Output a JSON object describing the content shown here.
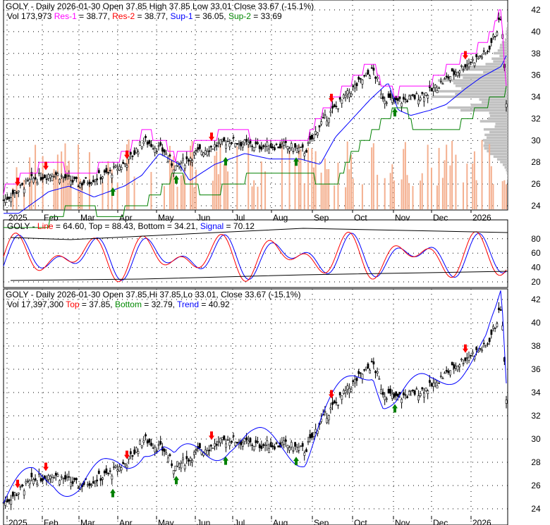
{
  "chart_data": [
    {
      "type": "candlestick",
      "title": "GOLY - Daily 2026-01-30 Open 37.85  High 37.85  Low 33.01  Close 33.67 (-15.1%)",
      "legend": {
        "vol": "Vol 173,973",
        "res1_label": "Res-1",
        "res1": " = 38.77, ",
        "res2_label": "Res-2",
        "res2": " = 38.77, ",
        "sup1_label": "Sup-1",
        "sup1": " = 36.05, ",
        "sup2_label": "Sup-2",
        "sup2": " = 33.69"
      },
      "y_ticks": [
        "42",
        "40",
        "38",
        "36",
        "34",
        "32",
        "30",
        "28",
        "26",
        "24"
      ],
      "ylim": [
        24,
        42
      ],
      "x_ticks": [
        "2025",
        "Feb",
        "Mar",
        "Apr",
        "May",
        "Jun",
        "Jul",
        "Aug",
        "Sep",
        "Oct",
        "Nov",
        "Dec",
        "2026"
      ],
      "price_path": [
        [
          0,
          24.5
        ],
        [
          0.06,
          26.5
        ],
        [
          0.1,
          27
        ],
        [
          0.15,
          26
        ],
        [
          0.21,
          27
        ],
        [
          0.245,
          28
        ],
        [
          0.28,
          30
        ],
        [
          0.32,
          29
        ],
        [
          0.34,
          27.5
        ],
        [
          0.39,
          29
        ],
        [
          0.45,
          30
        ],
        [
          0.5,
          29.5
        ],
        [
          0.56,
          29.5
        ],
        [
          0.6,
          29
        ],
        [
          0.63,
          31.5
        ],
        [
          0.66,
          33
        ],
        [
          0.7,
          35
        ],
        [
          0.735,
          36.5
        ],
        [
          0.755,
          34
        ],
        [
          0.78,
          33.5
        ],
        [
          0.82,
          34
        ],
        [
          0.85,
          34.5
        ],
        [
          0.89,
          36
        ],
        [
          0.92,
          37
        ],
        [
          0.96,
          38
        ],
        [
          0.98,
          40
        ],
        [
          0.99,
          41.5
        ],
        [
          1,
          33.67
        ]
      ]
    },
    {
      "type": "line",
      "title_prefix": "GOLY - ",
      "line_label": "Line",
      "line_val": " = 64.60, Top = 88.43, Bottom = 34.21, ",
      "signal_label": "Signal",
      "signal_val": " = 70.12",
      "y_ticks": [
        "80",
        "60",
        "40",
        "20"
      ],
      "ylim": [
        15,
        95
      ]
    },
    {
      "type": "candlestick",
      "title": "GOLY - Daily 2026-01-30 Open 37.85,Hi 37.85,Lo 33.01, Close 33.67 (-15.1%)",
      "legend": {
        "vol": "Vol 17,397,300 ",
        "top_label": "Top",
        "top": " = 37.85, ",
        "bottom_label": "Bottom",
        "bottom": " = 32.79, ",
        "trend_label": "Trend",
        "trend": " = 40.92"
      },
      "y_ticks": [
        "42",
        "40",
        "38",
        "36",
        "34",
        "32",
        "30",
        "28",
        "26",
        "24"
      ],
      "ylim": [
        24,
        42
      ],
      "x_ticks": [
        "2025",
        "Feb",
        "Mar",
        "Apr",
        "May",
        "Jun",
        "Jul",
        "Aug",
        "Sep",
        "Oct",
        "Nov",
        "Dec",
        "2026"
      ]
    }
  ],
  "colors": {
    "res1": "#ff00ff",
    "res2": "#ff0000",
    "sup1": "#0000ff",
    "sup2": "#008000",
    "line": "#ff0000",
    "signal": "#0000ff"
  }
}
